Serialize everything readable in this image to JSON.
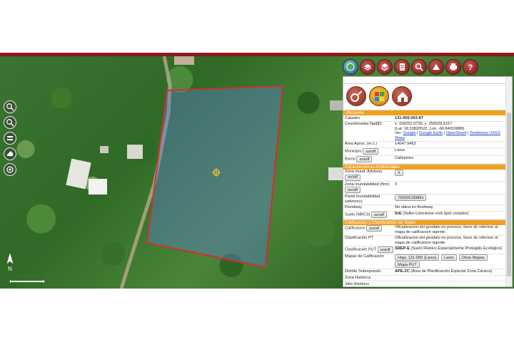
{
  "map": {
    "parcel_color": "#d32f2f",
    "parcel_fill": "#5a7fd6",
    "north_label": "N"
  },
  "left_tools": [
    "zoom-in-icon",
    "zoom-out-icon",
    "layers-icon",
    "measure-icon",
    "home-icon"
  ],
  "toolbar": {
    "buttons": [
      "globe-icon",
      "layers-icon",
      "layers-stack-icon",
      "document-icon",
      "search-icon",
      "measure-icon",
      "print-icon",
      "help-icon"
    ]
  },
  "panel": {
    "icons": [
      "link-icon",
      "orthophoto-icon",
      "building-icon"
    ],
    "sections": {
      "ubicacion": "Ubicación",
      "ambientales": "Características Ambientales",
      "calificacion": "Calificación y Clasificación de Suelo"
    },
    "rows": {
      "catastro_k": "Catastro",
      "catastro_v": "131-000-003-87",
      "coord_k": "Coordenadas Nad83",
      "coord_v1": "x: 156052.0735, y: 255929.5157",
      "coord_v2": "(Lat: 18.33820522, Lon: -66.84910888)",
      "ver_label": "Ver:",
      "link_google": "Google",
      "link_earth": "Google Earth",
      "link_osm": "OpenStreet",
      "link_usgs": "Temblores USGS",
      "link_waze": "Waze",
      "area_k": "Área Aprox. (m.c.)",
      "area_v": "14047.9463",
      "municipio_k": "Municipio",
      "municipio_v": "Lares",
      "barrio_k": "Barrio",
      "barrio_v": "Callejones",
      "onoff": "on/off",
      "zona_adv_k": "Zona Inund. Advisory",
      "zona_adv_v": "X",
      "zona_firm_k": "Zona Inundabilidad (firm)",
      "zona_firm_v": "X",
      "panel_k": "Panel Inundabilidad (advisory)",
      "panel_v": "72000C0580H",
      "floodway_k": "Floodway",
      "floodway_v": "No ubica en floodway",
      "suelo_k": "Suelo (NRCS)",
      "suelo_code": "SrE",
      "suelo_v": "(Soller-Limestone rock land complex)",
      "calif_k": "Calificación",
      "calif_v": "Oficializacion del geodato en proceso, favor de referirse al mapa de calificacion vigente.",
      "clasif_pt_k": "Clasificación PT",
      "clasif_pt_v": "Oficializacion del geodato en proceso, favor de referirse al mapa de calificacion vigente.",
      "clasif_put_k": "Clasificación PUT",
      "clasif_put_code": "SREP-E",
      "clasif_put_v": "(Suelo Rústico Especialmente Protegido Ecológico)",
      "mapas_k": "Mapas de Calificación",
      "btn_hoja": "Hoja: 131-000 (Lares)",
      "btn_lares": "Lares",
      "btn_otros": "Otros Mapas",
      "btn_put": "Mapa PUT",
      "distrito_k": "Distrito Sobrepuesto",
      "distrito_code": "APE-ZC",
      "distrito_v": "(Área de Planificación Especial Zona Cársica)",
      "zona_hist_k": "Zona Histórica",
      "sitio_hist_k": "Sitio Histórico"
    }
  }
}
